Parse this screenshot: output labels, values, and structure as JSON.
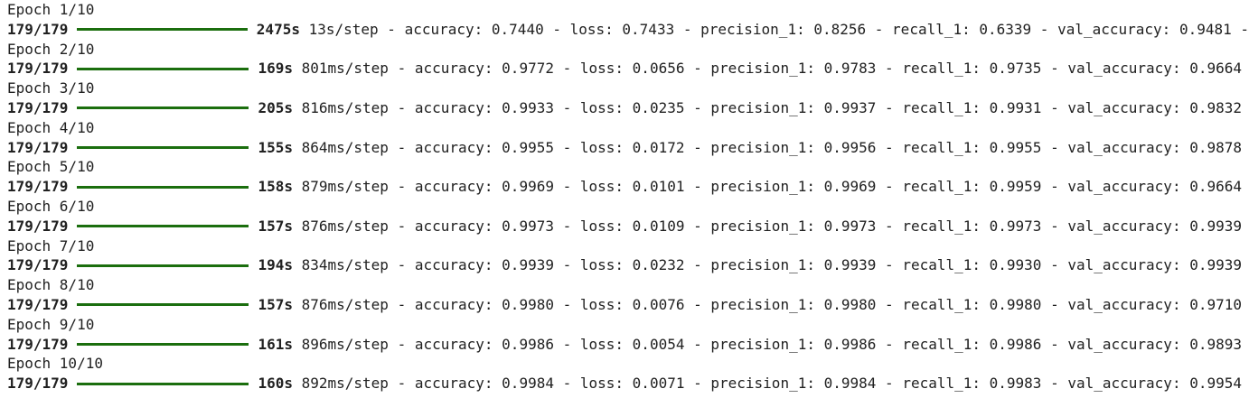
{
  "log": {
    "colors": {
      "progress_bar": "#1b6e0e",
      "text": "#212121",
      "background": "#ffffff"
    },
    "epochs": [
      {
        "header": "Epoch 1/10",
        "steps": "179/179",
        "progress": 1.0,
        "time": "2475s",
        "rate": "13s/step",
        "accuracy": "0.7440",
        "loss": "0.7433",
        "precision": "0.8256",
        "recall": "0.6339",
        "val_accuracy": "0.9481",
        "trailing": " -"
      },
      {
        "header": "Epoch 2/10",
        "steps": "179/179",
        "progress": 1.0,
        "time": "169s",
        "rate": "801ms/step",
        "accuracy": "0.9772",
        "loss": "0.0656",
        "precision": "0.9783",
        "recall": "0.9735",
        "val_accuracy": "0.9664",
        "trailing": ""
      },
      {
        "header": "Epoch 3/10",
        "steps": "179/179",
        "progress": 1.0,
        "time": "205s",
        "rate": "816ms/step",
        "accuracy": "0.9933",
        "loss": "0.0235",
        "precision": "0.9937",
        "recall": "0.9931",
        "val_accuracy": "0.9832",
        "trailing": ""
      },
      {
        "header": "Epoch 4/10",
        "steps": "179/179",
        "progress": 1.0,
        "time": "155s",
        "rate": "864ms/step",
        "accuracy": "0.9955",
        "loss": "0.0172",
        "precision": "0.9956",
        "recall": "0.9955",
        "val_accuracy": "0.9878",
        "trailing": ""
      },
      {
        "header": "Epoch 5/10",
        "steps": "179/179",
        "progress": 1.0,
        "time": "158s",
        "rate": "879ms/step",
        "accuracy": "0.9969",
        "loss": "0.0101",
        "precision": "0.9969",
        "recall": "0.9959",
        "val_accuracy": "0.9664",
        "trailing": ""
      },
      {
        "header": "Epoch 6/10",
        "steps": "179/179",
        "progress": 1.0,
        "time": "157s",
        "rate": "876ms/step",
        "accuracy": "0.9973",
        "loss": "0.0109",
        "precision": "0.9973",
        "recall": "0.9973",
        "val_accuracy": "0.9939",
        "trailing": ""
      },
      {
        "header": "Epoch 7/10",
        "steps": "179/179",
        "progress": 1.0,
        "time": "194s",
        "rate": "834ms/step",
        "accuracy": "0.9939",
        "loss": "0.0232",
        "precision": "0.9939",
        "recall": "0.9930",
        "val_accuracy": "0.9939",
        "trailing": ""
      },
      {
        "header": "Epoch 8/10",
        "steps": "179/179",
        "progress": 1.0,
        "time": "157s",
        "rate": "876ms/step",
        "accuracy": "0.9980",
        "loss": "0.0076",
        "precision": "0.9980",
        "recall": "0.9980",
        "val_accuracy": "0.9710",
        "trailing": ""
      },
      {
        "header": "Epoch 9/10",
        "steps": "179/179",
        "progress": 1.0,
        "time": "161s",
        "rate": "896ms/step",
        "accuracy": "0.9986",
        "loss": "0.0054",
        "precision": "0.9986",
        "recall": "0.9986",
        "val_accuracy": "0.9893",
        "trailing": ""
      },
      {
        "header": "Epoch 10/10",
        "steps": "179/179",
        "progress": 1.0,
        "time": "160s",
        "rate": "892ms/step",
        "accuracy": "0.9984",
        "loss": "0.0071",
        "precision": "0.9984",
        "recall": "0.9983",
        "val_accuracy": "0.9954",
        "trailing": ""
      }
    ],
    "labels": {
      "accuracy": "accuracy: ",
      "loss": "loss: ",
      "precision": "precision_1: ",
      "recall": "recall_1: ",
      "val_accuracy": "val_accuracy: ",
      "dash": " - "
    }
  }
}
